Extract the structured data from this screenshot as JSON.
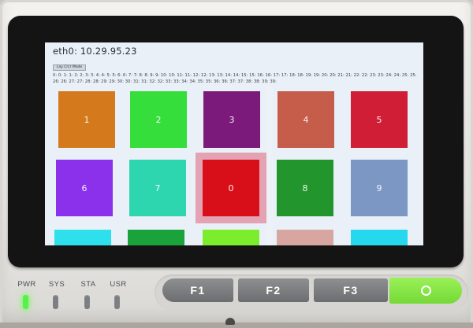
{
  "screen": {
    "ip_text": "eth0: 10.29.95.23",
    "mode_button": "Lay Crcr Mode",
    "counter_text": "0: 0: 1: 1: 2: 2: 3: 3: 4: 4: 5: 5: 6: 6: 7: 7: 8: 8: 9: 9: 10: 10: 11: 11: 12: 12: 13: 13: 14: 14: 15: 15: 16: 16: 17: 17: 18: 18: 19: 19: 20: 20: 21: 21: 22: 22: 23: 23: 24: 24: 25: 25: 26: 26: 27: 27: 28: 28: 29: 29: 30: 30: 31: 31: 32: 32: 33: 33: 34: 34: 35: 35: 36: 36: 37: 37: 38: 38: 39: 39:",
    "selected_tile": "0",
    "tiles": [
      {
        "label": "1",
        "color": "#d47a1d"
      },
      {
        "label": "2",
        "color": "#35de3b"
      },
      {
        "label": "3",
        "color": "#7b1a7a"
      },
      {
        "label": "4",
        "color": "#c65c4a"
      },
      {
        "label": "5",
        "color": "#cf1e35"
      },
      {
        "label": "6",
        "color": "#8b31ec"
      },
      {
        "label": "7",
        "color": "#2ed6b0"
      },
      {
        "label": "0",
        "color": "#d80f19"
      },
      {
        "label": "8",
        "color": "#22962c"
      },
      {
        "label": "9",
        "color": "#7c97c4"
      },
      {
        "label": "",
        "color": "#2de0ec"
      },
      {
        "label": "",
        "color": "#1aa23b"
      },
      {
        "label": "",
        "color": "#7bed2d"
      },
      {
        "label": "",
        "color": "#d8a6a0"
      },
      {
        "label": "",
        "color": "#26d8ee"
      }
    ]
  },
  "leds": [
    {
      "label": "PWR",
      "on": true
    },
    {
      "label": "SYS",
      "on": false
    },
    {
      "label": "STA",
      "on": false
    },
    {
      "label": "USR",
      "on": false
    }
  ],
  "buttons": {
    "f1": "F1",
    "f2": "F2",
    "f3": "F3",
    "ok_icon": "circle-icon"
  },
  "colors": {
    "led_on": "#58f04a",
    "ok_button": "#7fe23c",
    "fkey": "#7b7c7f"
  }
}
